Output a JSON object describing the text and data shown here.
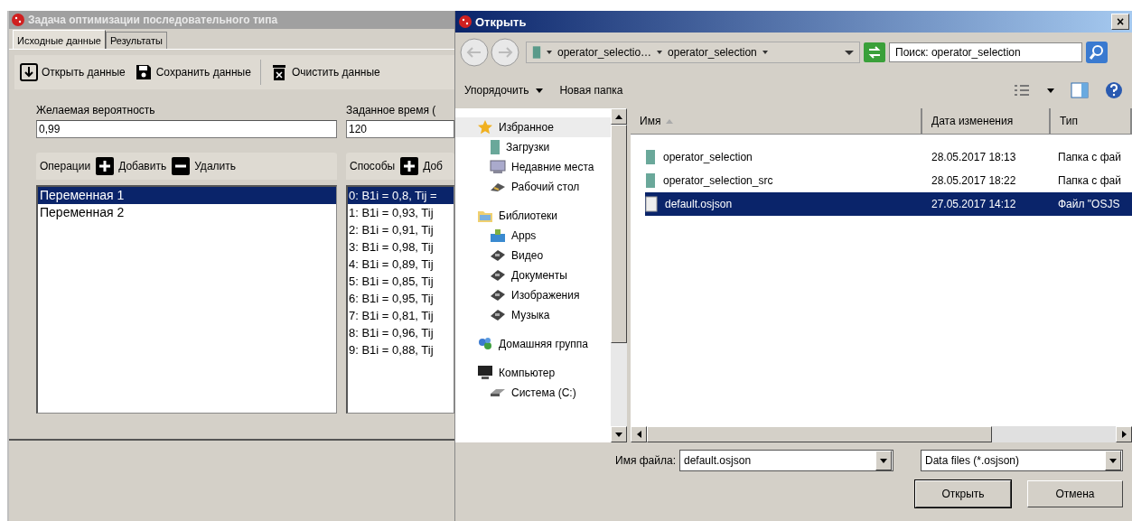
{
  "main_window": {
    "title": "Задача оптимизации последовательного типа",
    "tabs": [
      {
        "label": "Исходные данные",
        "selected": true
      },
      {
        "label": "Результаты",
        "selected": false
      }
    ],
    "toolbar": [
      {
        "kind": "open",
        "label": "Открыть данные"
      },
      {
        "kind": "save",
        "label": "Сохранить данные"
      },
      {
        "kind": "clear",
        "label": "Очистить данные"
      }
    ],
    "fields": [
      {
        "label": "Желаемая вероятность",
        "value": "0,99"
      },
      {
        "label": "Заданное время (",
        "value": "120"
      }
    ],
    "operations": {
      "title": "Операции",
      "add": "Добавить",
      "remove": "Удалить",
      "items": [
        {
          "label": "Переменная 1",
          "selected": true
        },
        {
          "label": "Переменная 2",
          "selected": false
        }
      ]
    },
    "methods": {
      "title": "Способы",
      "add": "Доб",
      "items": [
        {
          "label": "0: B1i = 0,8, Tij =",
          "selected": true
        },
        {
          "label": "1: B1i = 0,93, Tij",
          "selected": false
        },
        {
          "label": "2: B1i = 0,91, Tij",
          "selected": false
        },
        {
          "label": "3: B1i = 0,98, Tij",
          "selected": false
        },
        {
          "label": "4: B1i = 0,89, Tij",
          "selected": false
        },
        {
          "label": "5: B1i = 0,85, Tij",
          "selected": false
        },
        {
          "label": "6: B1i = 0,95, Tij",
          "selected": false
        },
        {
          "label": "7: B1i = 0,81, Tij",
          "selected": false
        },
        {
          "label": "8: B1i = 0,96, Tij",
          "selected": false
        },
        {
          "label": "9: B1i = 0,88, Tij",
          "selected": false
        }
      ]
    }
  },
  "dialog": {
    "title": "Открыть",
    "close": "×",
    "breadcrumbs": [
      "operator_selectio…",
      "operator_selection"
    ],
    "search": {
      "placeholder": "Поиск: operator_selection"
    },
    "commands": [
      "Упорядочить",
      "Новая папка"
    ],
    "nav": [
      {
        "kind": "star",
        "label": "Избранное",
        "selected": true,
        "children": [
          {
            "kind": "folder",
            "label": "Загрузки"
          },
          {
            "kind": "recent",
            "label": "Недавние места"
          },
          {
            "kind": "desktop",
            "label": "Рабочий стол"
          }
        ]
      },
      {
        "kind": "library",
        "label": "Библиотеки",
        "selected": false,
        "children": [
          {
            "kind": "apps",
            "label": "Apps"
          },
          {
            "kind": "video",
            "label": "Видео"
          },
          {
            "kind": "docs",
            "label": "Документы"
          },
          {
            "kind": "images",
            "label": "Изображения"
          },
          {
            "kind": "music",
            "label": "Музыка"
          }
        ]
      },
      {
        "kind": "homegroup",
        "label": "Домашняя группа",
        "selected": false
      },
      {
        "kind": "computer",
        "label": "Компьютер",
        "selected": false,
        "children": [
          {
            "kind": "drive",
            "label": "Система (C:)"
          }
        ]
      }
    ],
    "columns": [
      "Имя",
      "Дата изменения",
      "Тип"
    ],
    "files": [
      {
        "kind": "folder",
        "name": "operator_selection",
        "date": "28.05.2017 18:13",
        "type": "Папка с фай",
        "selected": false
      },
      {
        "kind": "folder",
        "name": "operator_selection_src",
        "date": "28.05.2017 18:22",
        "type": "Папка с фай",
        "selected": false
      },
      {
        "kind": "file",
        "name": "default.osjson",
        "date": "27.05.2017 14:12",
        "type": "Файл \"OSJS",
        "selected": true
      }
    ],
    "filename": {
      "label": "Имя файла:",
      "value": "default.osjson"
    },
    "filter": {
      "value": "Data files (*.osjson)"
    },
    "buttons": [
      "Открыть",
      "Отмена"
    ]
  }
}
